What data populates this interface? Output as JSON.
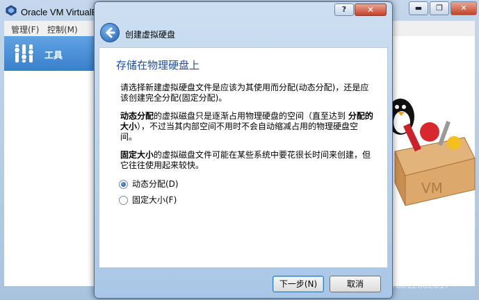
{
  "main_window": {
    "title": "Oracle VM VirtualBox 管理器",
    "minimize": "▬",
    "maximize": "❐",
    "close": "✕",
    "menus": [
      "管理(F)",
      "控制(M)"
    ],
    "tools_label": "工具"
  },
  "dialog": {
    "title": "创建虚拟硬盘",
    "help": "?",
    "close": "✕",
    "heading": "存储在物理硬盘上",
    "para1": "请选择新建虚拟硬盘文件是应该为其使用而分配(动态分配)，还是应该创建完全分配(固定分配)。",
    "para2_bold1": "动态分配",
    "para2_text1": "的虚拟磁盘只是逐渐占用物理硬盘的空间（直至达到 ",
    "para2_bold2": "分配的大小",
    "para2_text2": "），不过当其内部空间不用时不会自动缩减占用的物理硬盘空间。",
    "para3_bold": "固定大小",
    "para3_text": "的虚拟磁盘文件可能在某些系统中要花很长时间来创建，但它往往使用起来较快。",
    "options": [
      {
        "label": "动态分配(D)",
        "checked": true
      },
      {
        "label": "固定大小(F)",
        "checked": false
      }
    ],
    "next_button": "下一步(N)",
    "cancel_button": "取消"
  },
  "watermark": "https://blog.csdn.net/u012082017",
  "colors": {
    "heading": "#1e4ea3",
    "tools_bg": "#3a7fcc",
    "close_red": "#c4432a"
  }
}
